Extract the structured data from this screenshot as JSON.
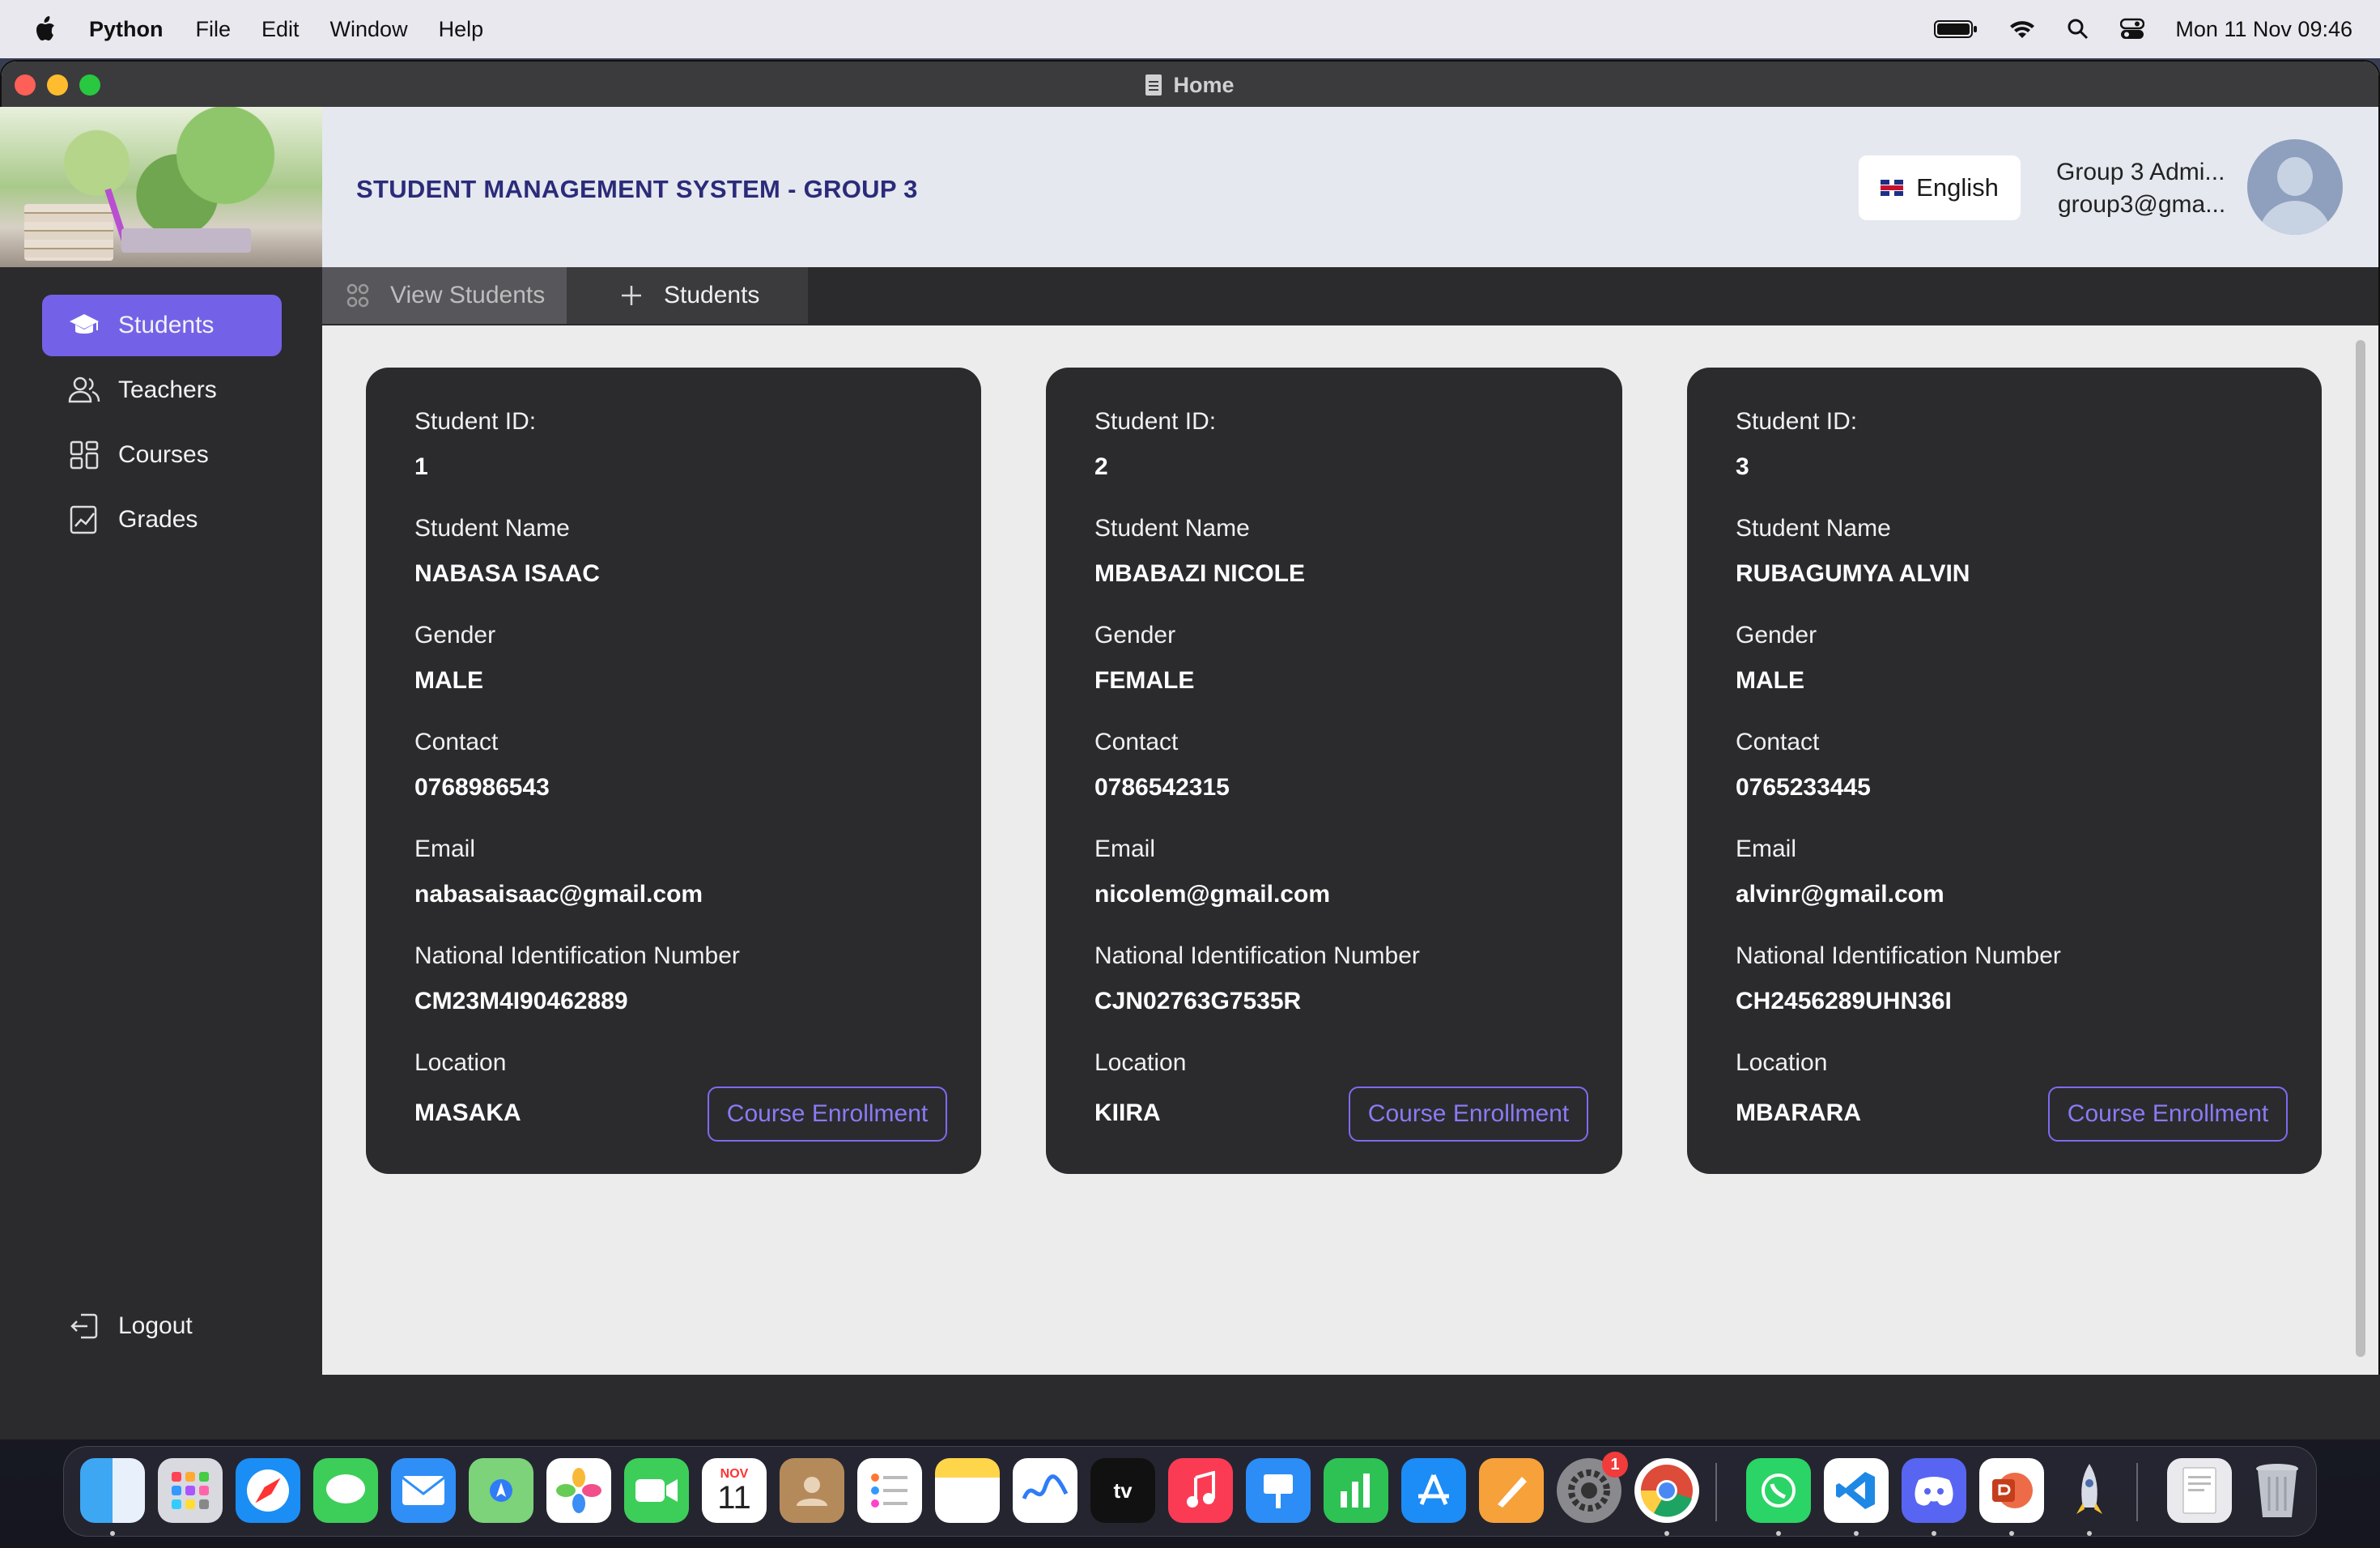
{
  "menubar": {
    "app_name": "Python",
    "items": [
      "File",
      "Edit",
      "Window",
      "Help"
    ],
    "clock": "Mon 11 Nov  09:46"
  },
  "window": {
    "title": "Home"
  },
  "header": {
    "title": "STUDENT MANAGEMENT SYSTEM - GROUP 3",
    "language": "English",
    "user_name": "Group 3 Admi...",
    "user_email": "group3@gma..."
  },
  "sidebar": {
    "items": [
      {
        "label": "Students",
        "icon": "graduation-cap-icon",
        "active": true
      },
      {
        "label": "Teachers",
        "icon": "users-icon",
        "active": false
      },
      {
        "label": "Courses",
        "icon": "grid-icon",
        "active": false
      },
      {
        "label": "Grades",
        "icon": "chart-icon",
        "active": false
      }
    ],
    "logout": "Logout"
  },
  "tabs": [
    {
      "label": "View Students",
      "icon": "users-group-icon"
    },
    {
      "label": "Students",
      "icon": "plus-icon"
    }
  ],
  "labels": {
    "student_id": "Student ID:",
    "student_name": "Student Name",
    "gender": "Gender",
    "contact": "Contact",
    "email": "Email",
    "nin": "National Identification Number",
    "location": "Location",
    "enroll_button": "Course Enrollment"
  },
  "students": [
    {
      "id": "1",
      "name": "NABASA ISAAC",
      "gender": "MALE",
      "contact": "0768986543",
      "email": "nabasaisaac@gmail.com",
      "nin": "CM23M4I90462889",
      "location": "MASAKA"
    },
    {
      "id": "2",
      "name": "MBABAZI NICOLE",
      "gender": "FEMALE",
      "contact": "0786542315",
      "email": "nicolem@gmail.com",
      "nin": "CJN02763G7535R",
      "location": "KIIRA"
    },
    {
      "id": "3",
      "name": "RUBAGUMYA  ALVIN",
      "gender": "MALE",
      "contact": "0765233445",
      "email": "alvinr@gmail.com",
      "nin": "CH2456289UHN36I",
      "location": "MBARARA"
    }
  ],
  "dock": {
    "calendar_month": "NOV",
    "calendar_day": "11",
    "settings_badge": "1",
    "appletv_label": "tv"
  },
  "colors": {
    "accent": "#7362e8",
    "card_bg": "#2b2b2d",
    "title": "#2b2b7a"
  }
}
